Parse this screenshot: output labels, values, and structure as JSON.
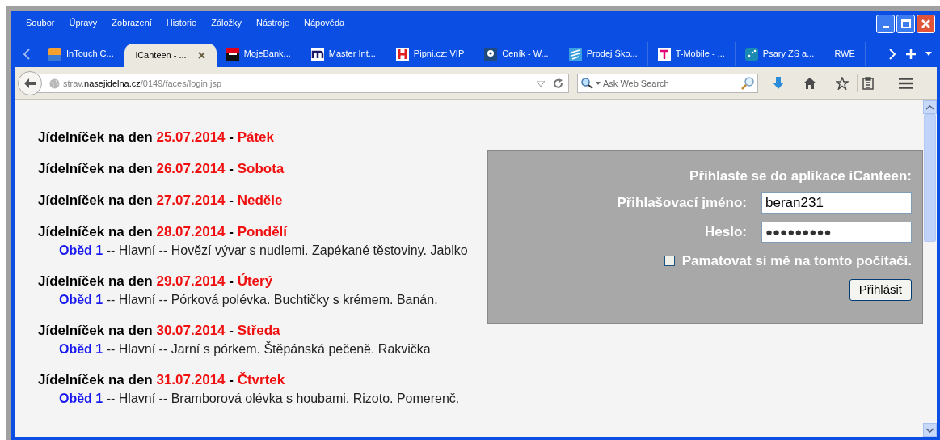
{
  "menu": [
    "Soubor",
    "Úpravy",
    "Zobrazení",
    "Historie",
    "Záložky",
    "Nástroje",
    "Nápověda"
  ],
  "tabs": [
    {
      "label": "InTouch C...",
      "selected": false
    },
    {
      "label": "iCanteen - ...",
      "selected": true
    },
    {
      "label": "MojeBank...",
      "selected": false
    },
    {
      "label": "Master Int...",
      "selected": false
    },
    {
      "label": "Pipni.cz: VIP",
      "selected": false
    },
    {
      "label": "Ceník - W...",
      "selected": false
    },
    {
      "label": "Prodej Ško...",
      "selected": false
    },
    {
      "label": "T-Mobile - ...",
      "selected": false
    },
    {
      "label": "Psary ZS a...",
      "selected": false
    },
    {
      "label": "RWE",
      "selected": false
    }
  ],
  "address": {
    "prefix": "strav.",
    "domain": "nasejidelna.cz",
    "path": "/0149/faces/login.jsp"
  },
  "search": {
    "placeholder": "Ask Web Search"
  },
  "days": [
    {
      "heading": "Jídelníček na den",
      "date": "25.07.2014",
      "separator": "-",
      "day": "Pátek"
    },
    {
      "heading": "Jídelníček na den",
      "date": "26.07.2014",
      "separator": "-",
      "day": "Sobota"
    },
    {
      "heading": "Jídelníček na den",
      "date": "27.07.2014",
      "separator": "-",
      "day": "Neděle"
    },
    {
      "heading": "Jídelníček na den",
      "date": "28.07.2014",
      "separator": "-",
      "day": "Pondělí",
      "meals": [
        {
          "label": "Oběd 1",
          "text": "-- Hlavní -- Hovězí vývar s nudlemi. Zapékané těstoviny. Jablko"
        }
      ]
    },
    {
      "heading": "Jídelníček na den",
      "date": "29.07.2014",
      "separator": "-",
      "day": "Úterý",
      "meals": [
        {
          "label": "Oběd 1",
          "text": "-- Hlavní -- Pórková polévka. Buchtičky s krémem. Banán."
        }
      ]
    },
    {
      "heading": "Jídelníček na den",
      "date": "30.07.2014",
      "separator": "-",
      "day": "Středa",
      "meals": [
        {
          "label": "Oběd 1",
          "text": "-- Hlavní -- Jarní s pórkem. Štěpánská pečeně. Rakvička"
        }
      ]
    },
    {
      "heading": "Jídelníček na den",
      "date": "31.07.2014",
      "separator": "-",
      "day": "Čtvrtek",
      "meals": [
        {
          "label": "Oběd 1",
          "text": "-- Hlavní -- Bramborová olévka s houbami. Rizoto. Pomerenč."
        }
      ]
    }
  ],
  "login": {
    "title": "Přihlaste se do aplikace iCanteen:",
    "username_label": "Přihlašovací jméno:",
    "username": "beran231",
    "password_label": "Heslo:",
    "password": "●●●●●●●●●",
    "remember": {
      "label": "Pamatovat si mě na tomto počítači.",
      "checked": false
    },
    "submit": "Přihlásit"
  }
}
